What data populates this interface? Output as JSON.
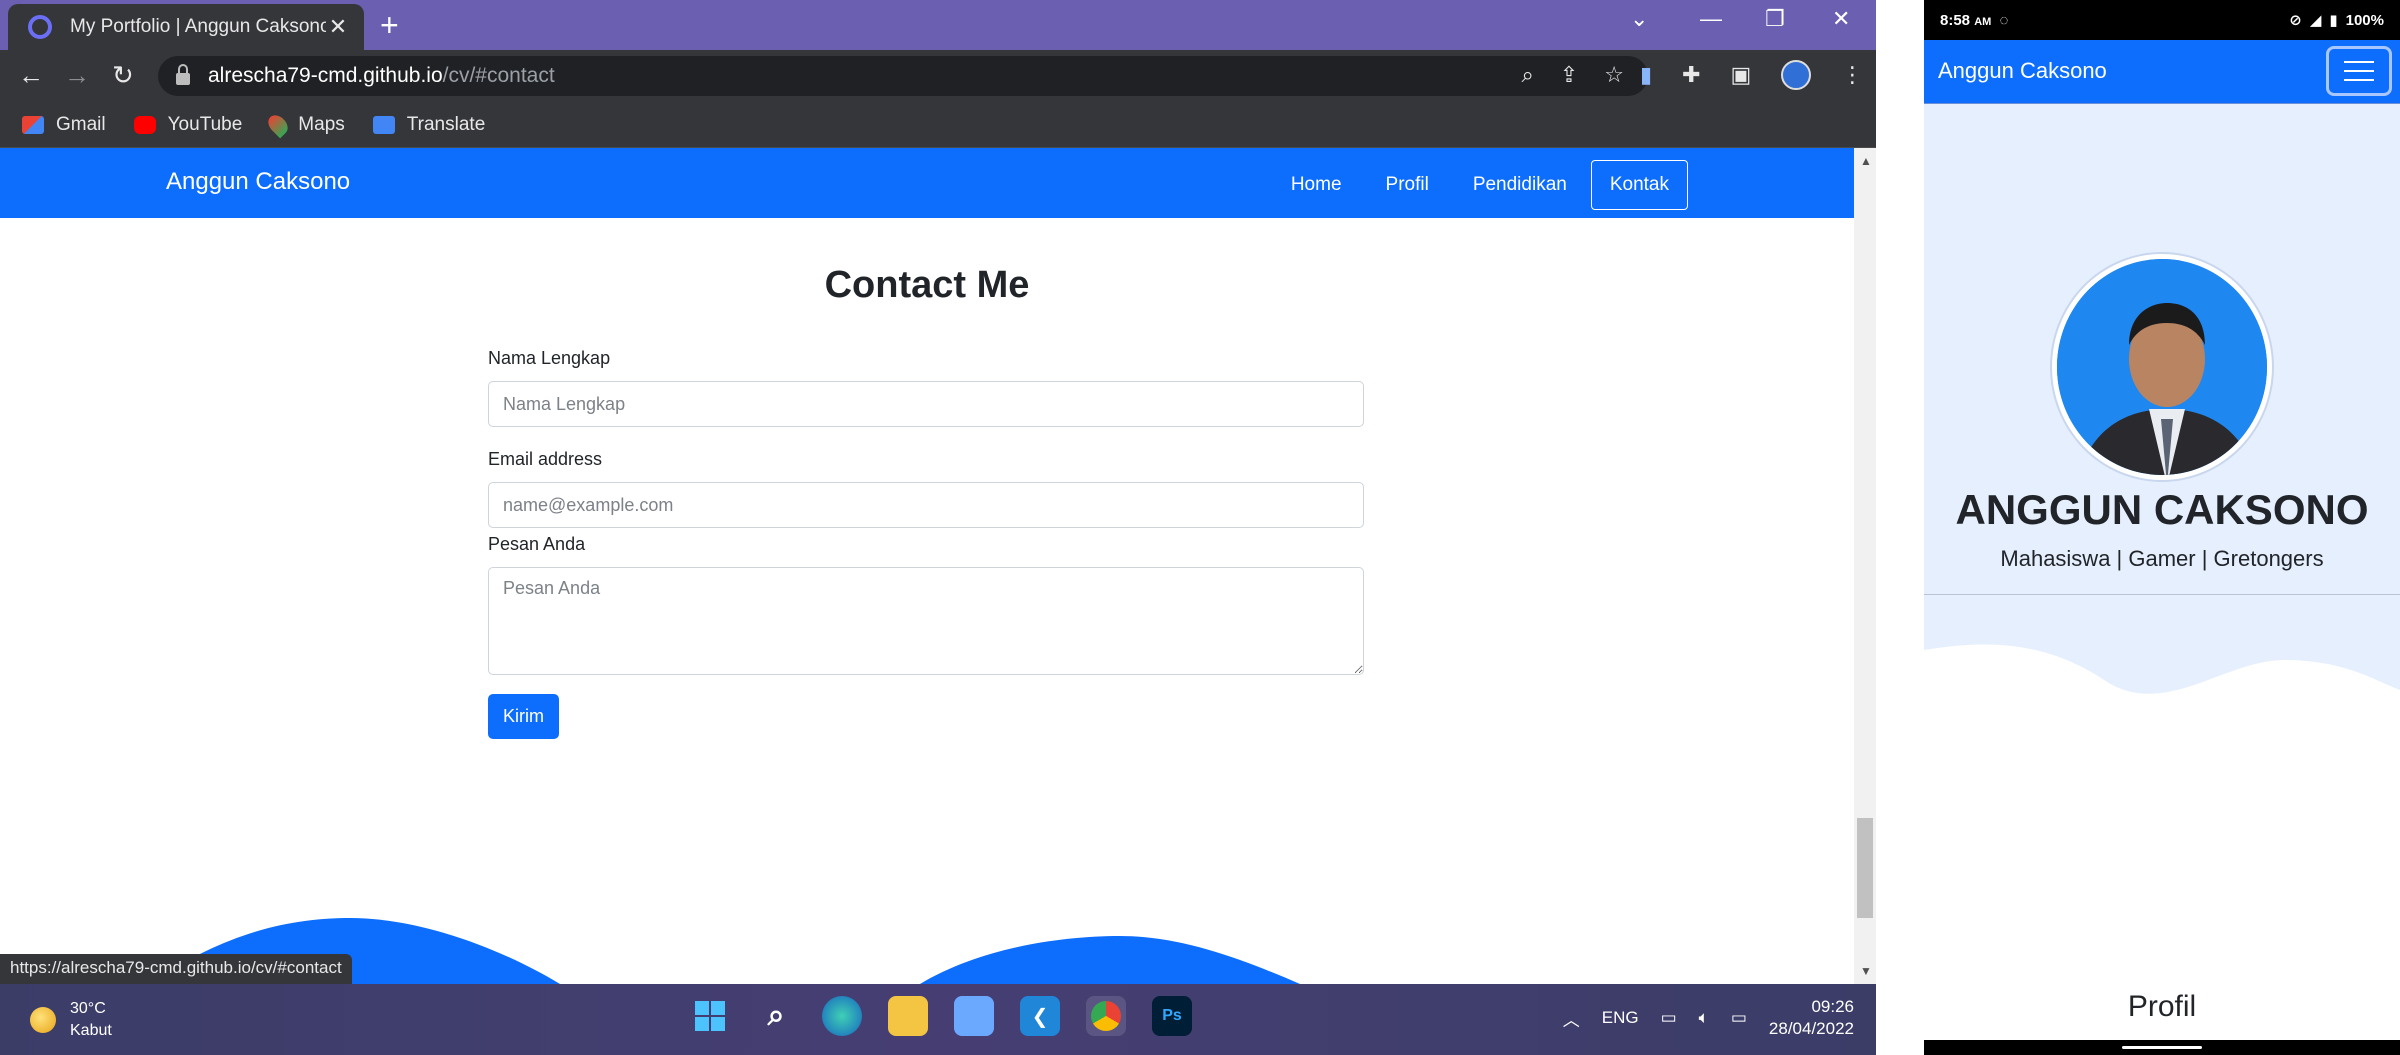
{
  "browser": {
    "tab_title": "My Portfolio | Anggun Caksono",
    "url_host": "alrescha79-cmd.github.io",
    "url_path": "/cv/#contact",
    "status_url": "https://alrescha79-cmd.github.io/cv/#contact",
    "bookmarks": [
      "Gmail",
      "YouTube",
      "Maps",
      "Translate"
    ]
  },
  "site": {
    "brand": "Anggun Caksono",
    "nav": [
      "Home",
      "Profil",
      "Pendidikan",
      "Kontak"
    ],
    "contact_title": "Contact Me",
    "form": {
      "name_label": "Nama Lengkap",
      "name_placeholder": "Nama Lengkap",
      "email_label": "Email address",
      "email_placeholder": "name@example.com",
      "message_label": "Pesan Anda",
      "message_placeholder": "Pesan Anda",
      "submit_label": "Kirim"
    },
    "accent_color": "#0d6efd"
  },
  "taskbar": {
    "temperature": "30°C",
    "weather": "Kabut",
    "language": "ENG",
    "time": "09:26",
    "date": "28/04/2022"
  },
  "phone": {
    "status_time": "8:58",
    "status_ampm": "AM",
    "battery": "100%",
    "brand": "Anggun Caksono",
    "name": "ANGGUN CAKSONO",
    "tagline": "Mahasiswa | Gamer | Gretongers",
    "section_title": "Profil"
  }
}
